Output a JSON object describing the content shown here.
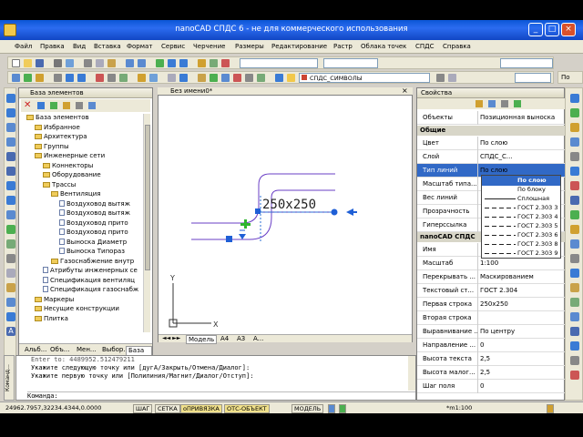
{
  "window": {
    "title": "nanoCAD СПДС 6 - не для коммерческого использования"
  },
  "menu": [
    "Файл",
    "Правка",
    "Вид",
    "Вставка",
    "Формат",
    "Сервис",
    "Черчение",
    "Размеры",
    "Редактирование",
    "Растр",
    "Облака точек",
    "СПДС",
    "Справка"
  ],
  "layer_combo": "СПДС_СИМВОЛЫ",
  "left_panel": {
    "title": "База элементов",
    "tree": [
      {
        "label": "База элементов",
        "level": 0,
        "icon": "folder"
      },
      {
        "label": "Избранное",
        "level": 1,
        "icon": "folder"
      },
      {
        "label": "Архитектура",
        "level": 1,
        "icon": "folder"
      },
      {
        "label": "Группы",
        "level": 1,
        "icon": "folder"
      },
      {
        "label": "Инженерные сети",
        "level": 1,
        "icon": "folder"
      },
      {
        "label": "Коннекторы",
        "level": 2,
        "icon": "folder"
      },
      {
        "label": "Оборудование",
        "level": 2,
        "icon": "folder"
      },
      {
        "label": "Трассы",
        "level": 2,
        "icon": "folder"
      },
      {
        "label": "Вентиляция",
        "level": 3,
        "icon": "folder"
      },
      {
        "label": "Воздуховод вытяж",
        "level": 4,
        "icon": "doc"
      },
      {
        "label": "Воздуховод вытяж",
        "level": 4,
        "icon": "doc"
      },
      {
        "label": "Воздуховод прито",
        "level": 4,
        "icon": "doc"
      },
      {
        "label": "Воздуховод прито",
        "level": 4,
        "icon": "doc"
      },
      {
        "label": "Выноска Диаметр",
        "level": 4,
        "icon": "doc"
      },
      {
        "label": "Выноска Типораз",
        "level": 4,
        "icon": "doc"
      },
      {
        "label": "Газоснабжение внутр",
        "level": 3,
        "icon": "folder"
      },
      {
        "label": "Атрибуты инженерных се",
        "level": 2,
        "icon": "doc"
      },
      {
        "label": "Спецификация вентиляц",
        "level": 2,
        "icon": "doc"
      },
      {
        "label": "Спецификация газоснабж",
        "level": 2,
        "icon": "doc"
      },
      {
        "label": "Маркеры",
        "level": 1,
        "icon": "folder"
      },
      {
        "label": "Несущие конструкции",
        "level": 1,
        "icon": "folder"
      },
      {
        "label": "Плитка",
        "level": 1,
        "icon": "folder"
      }
    ],
    "tabs": [
      "Альб...",
      "Объ...",
      "Мен...",
      "Выбор...",
      "База ..."
    ]
  },
  "drawing": {
    "tab_title": "Без имени0*",
    "dimension_text": "250x250",
    "layout_tabs": [
      "Модель",
      "A4",
      "A3",
      "A..."
    ]
  },
  "props": {
    "title": "Свойства",
    "objects_label": "Объекты",
    "objects_value": "Позиционная выноска",
    "group_general": "Общие",
    "general": [
      {
        "k": "Цвет",
        "v": "По слою"
      },
      {
        "k": "Слой",
        "v": "СПДС_С..."
      },
      {
        "k": "Тип линий",
        "v": "По слою"
      },
      {
        "k": "Масштаб типа...",
        "v": ""
      },
      {
        "k": "Вес линий",
        "v": ""
      },
      {
        "k": "Прозрачность",
        "v": ""
      },
      {
        "k": "Гиперссылка",
        "v": ""
      }
    ],
    "group_spds": "nanoCAD СПДС",
    "spds": [
      {
        "k": "Имя",
        "v": ""
      },
      {
        "k": "Масштаб",
        "v": "1:100"
      },
      {
        "k": "Перекрывать ...",
        "v": "Маскированием"
      },
      {
        "k": "Текстовый ст...",
        "v": "ГОСТ 2.304"
      },
      {
        "k": "Первая строка",
        "v": "250x250"
      },
      {
        "k": "Вторая строка",
        "v": ""
      },
      {
        "k": "Выравнивание ...",
        "v": "По центру"
      },
      {
        "k": "Направление ...",
        "v": "0"
      },
      {
        "k": "Высота текста",
        "v": "2,5"
      },
      {
        "k": "Высота малог...",
        "v": "2,5"
      },
      {
        "k": "Шаг поля",
        "v": "0"
      }
    ],
    "linetype_options": [
      "По слою",
      "По блоку",
      "Сплошная",
      "ГОСТ 2.303 3",
      "ГОСТ 2.303 4",
      "ГОСТ 2.303 5",
      "ГОСТ 2.303 6",
      "ГОСТ 2.303 8",
      "ГОСТ 2.303 9"
    ]
  },
  "command": {
    "lines": [
      "Enter to: 4489952.512479211",
      "Укажите следующую точку или [дугА/Закрыть/Отмена/Диалог]:",
      "Укажите первую точку или [Полилиния/Магнит/Диалог/Отступ]:"
    ],
    "prompt": "Команда:",
    "side_label": "Команд..."
  },
  "status": {
    "coords": "24962.7957,32234.4344,0.0000",
    "buttons": [
      "ШАГ",
      "СЕТКА",
      "оПРИВЯЗКА",
      "ОТС-ОБЪЕКТ",
      "МОДЕЛЬ",
      "*m1:100"
    ]
  }
}
